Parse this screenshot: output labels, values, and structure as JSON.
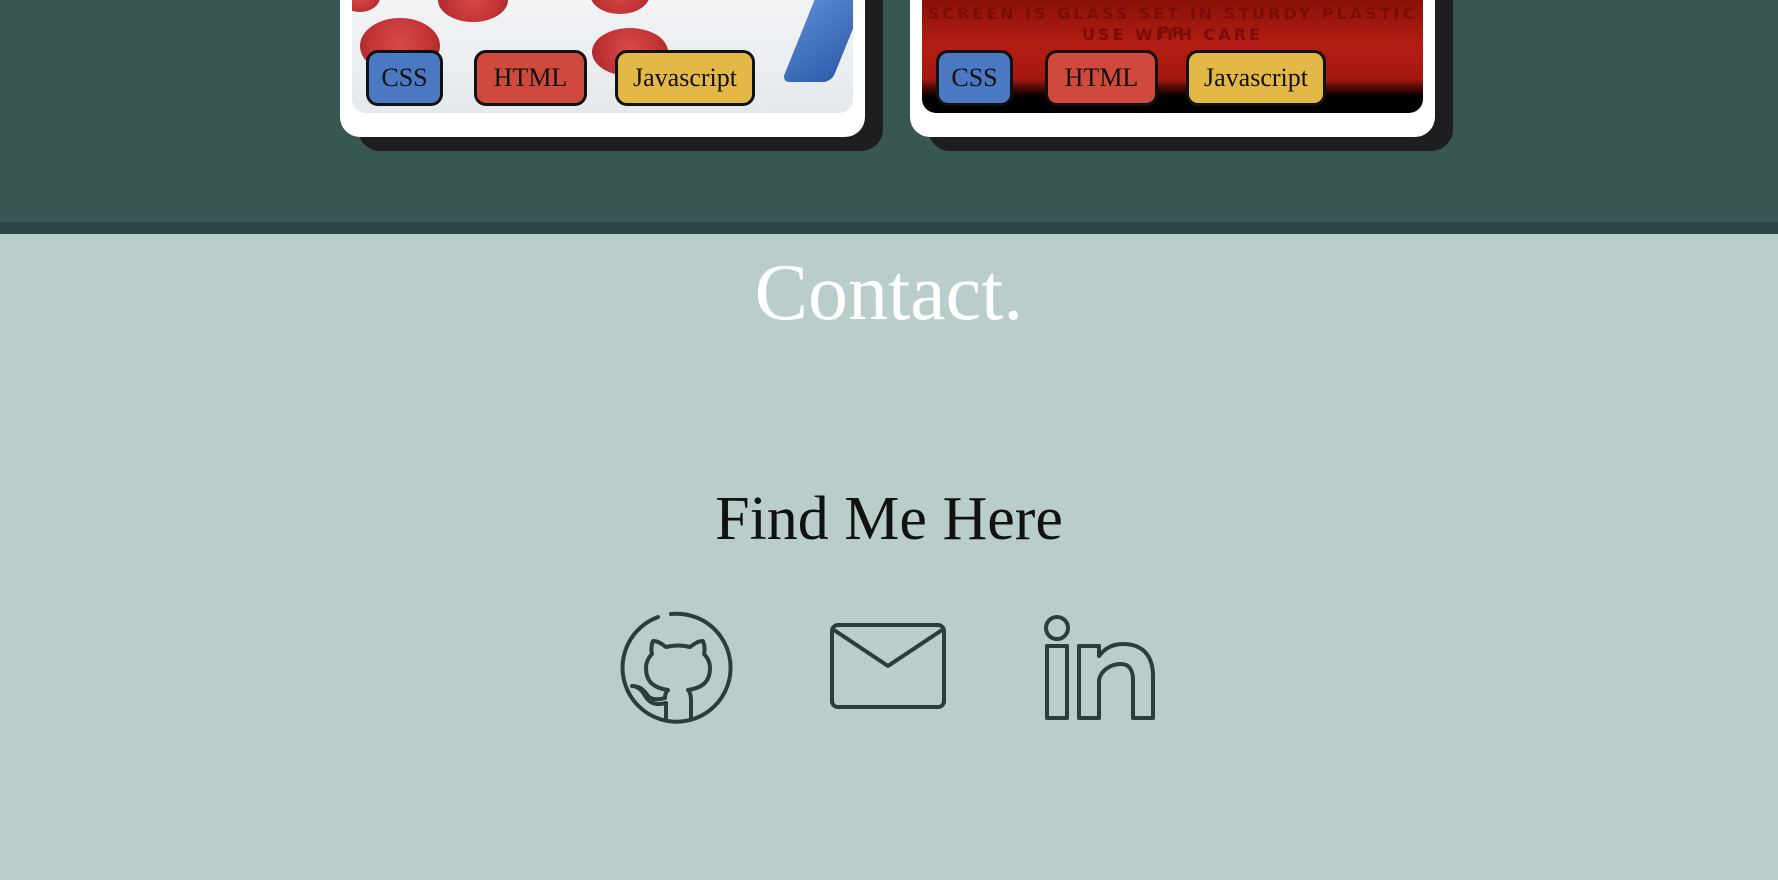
{
  "projects": {
    "cards": [
      {
        "image": "checkers-pieces",
        "tags": [
          "CSS",
          "HTML",
          "Javascript"
        ]
      },
      {
        "image": "etch-a-sketch",
        "screen_text": [
          "SCREEN IS GLASS SET IN STURDY PLASTIC FR",
          "USE WITH CARE"
        ],
        "tags": [
          "CSS",
          "HTML",
          "Javascript"
        ]
      }
    ],
    "tag_colors": {
      "CSS": "#4a78c2",
      "HTML": "#cf4a3c",
      "Javascript": "#e4b846"
    }
  },
  "contact": {
    "title": "Contact.",
    "subtitle": "Find Me Here",
    "links": [
      {
        "icon": "github-icon"
      },
      {
        "icon": "mail-icon"
      },
      {
        "icon": "linkedin-icon"
      }
    ]
  },
  "colors": {
    "projects_bg": "#385752",
    "contact_bg": "#b9cdcb",
    "icon_stroke": "#2b3d3d"
  }
}
